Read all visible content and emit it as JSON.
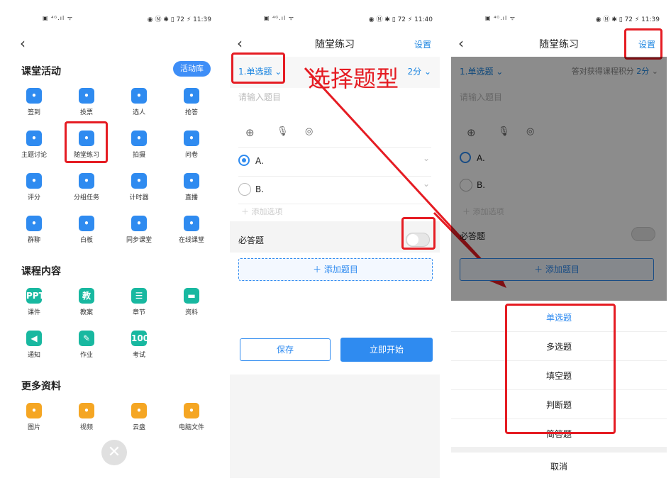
{
  "status": {
    "panel1_time": "11:39",
    "panel2_time": "11:40",
    "panel3_time": "11:39",
    "battery": "72"
  },
  "panel1": {
    "section_activity": "课堂活动",
    "activity_lib": "活动库",
    "activities": [
      {
        "label": "签到",
        "icon": "hand-tap-icon"
      },
      {
        "label": "投票",
        "icon": "bar-chart-icon"
      },
      {
        "label": "选人",
        "icon": "person-check-icon"
      },
      {
        "label": "抢答",
        "icon": "microphone-icon"
      },
      {
        "label": "主题讨论",
        "icon": "chat-bubble-icon"
      },
      {
        "label": "随堂练习",
        "icon": "exercise-doc-icon"
      },
      {
        "label": "拍摄",
        "icon": "camera-icon"
      },
      {
        "label": "问卷",
        "icon": "question-icon"
      },
      {
        "label": "评分",
        "icon": "lotus-icon"
      },
      {
        "label": "分组任务",
        "icon": "clipboard-check-icon"
      },
      {
        "label": "计时器",
        "icon": "clock-icon"
      },
      {
        "label": "直播",
        "icon": "play-circle-icon"
      },
      {
        "label": "群聊",
        "icon": "group-chat-icon"
      },
      {
        "label": "白板",
        "icon": "whiteboard-icon"
      },
      {
        "label": "同步课堂",
        "icon": "sync-class-icon"
      },
      {
        "label": "在线课堂",
        "icon": "online-class-icon"
      }
    ],
    "section_content": "课程内容",
    "contents": [
      {
        "label": "课件",
        "icon": "ppt-icon",
        "glyph": "PPT"
      },
      {
        "label": "教案",
        "icon": "lesson-plan-icon",
        "glyph": "教"
      },
      {
        "label": "章节",
        "icon": "chapter-list-icon",
        "glyph": "☰"
      },
      {
        "label": "资料",
        "icon": "folder-icon",
        "glyph": "▬"
      },
      {
        "label": "通知",
        "icon": "speaker-icon",
        "glyph": "◀"
      },
      {
        "label": "作业",
        "icon": "homework-icon",
        "glyph": "✎"
      },
      {
        "label": "考试",
        "icon": "exam-icon",
        "glyph": "100"
      }
    ],
    "section_more": "更多资料",
    "more": [
      {
        "label": "图片",
        "icon": "image-icon"
      },
      {
        "label": "视频",
        "icon": "video-icon"
      },
      {
        "label": "云盘",
        "icon": "cloud-icon"
      },
      {
        "label": "电脑文件",
        "icon": "monitor-icon"
      }
    ]
  },
  "panel2": {
    "title": "随堂练习",
    "settings": "设置",
    "question_type": "1.单选题",
    "score": "2分",
    "question_placeholder": "请输入题目",
    "option_a": "A.",
    "option_b": "B.",
    "add_option": "添加选项",
    "required_label": "必答题",
    "add_question": "添加题目",
    "save": "保存",
    "start_now": "立即开始"
  },
  "panel3": {
    "title": "随堂练习",
    "settings": "设置",
    "question_type": "1.单选题",
    "score_hint": "答对获得课程积分",
    "score": "2分",
    "question_placeholder": "请输入题目",
    "option_a": "A.",
    "option_b": "B.",
    "add_option": "添加选项",
    "required_label": "必答题",
    "add_question": "添加题目",
    "sheet_options": [
      "单选题",
      "多选题",
      "填空题",
      "判断题",
      "简答题"
    ],
    "cancel": "取消"
  },
  "annotation": "选择题型",
  "colors": {
    "accent": "#2f8bf0",
    "highlight": "#e51c23",
    "teal": "#18b8a0"
  }
}
